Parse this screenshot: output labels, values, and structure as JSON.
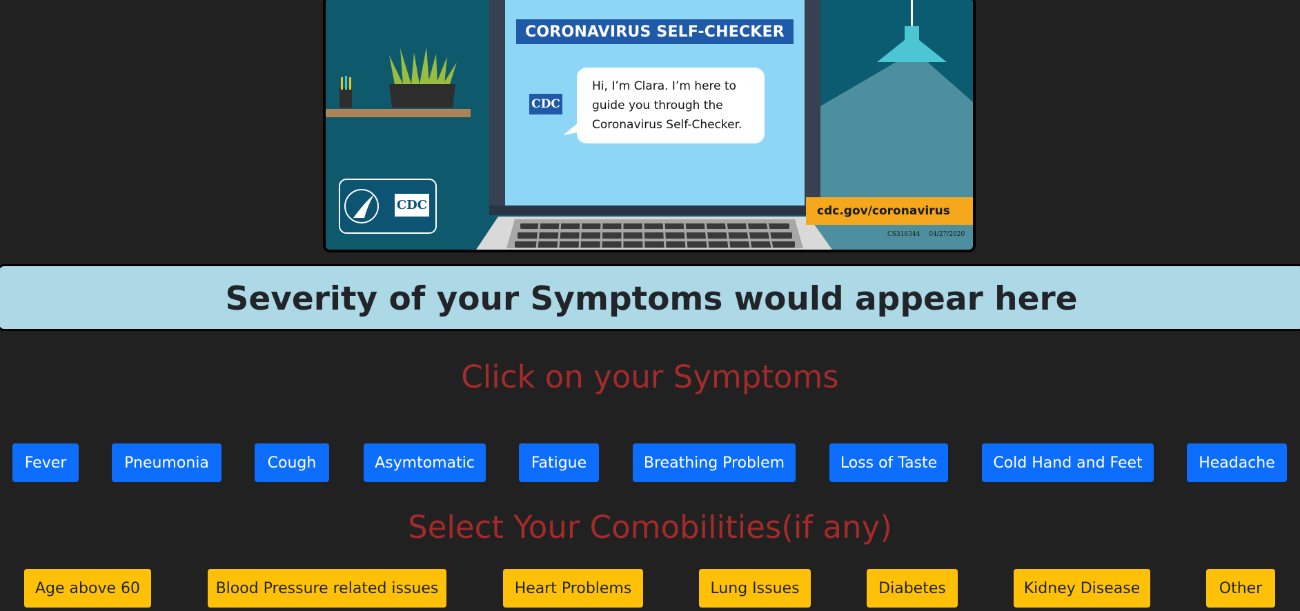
{
  "banner": {
    "screen_title": "CORONAVIRUS SELF-CHECKER",
    "bubble_lines": [
      "Hi, I’m Clara. I’m here to",
      "guide you through the",
      "Coronavirus Self-Checker."
    ],
    "cdc_label": "CDC",
    "url": "cdc.gov/coronavirus",
    "code": "CS316344",
    "date": "04/27/2020"
  },
  "severity": {
    "text": "Severity of your Symptoms would appear here"
  },
  "symptoms": {
    "title": "Click on your Symptoms",
    "items": [
      "Fever",
      "Pneumonia",
      "Cough",
      "Asymtomatic",
      "Fatigue",
      "Breathing Problem",
      "Loss of Taste",
      "Cold Hand and Feet",
      "Headache"
    ]
  },
  "comorbidities": {
    "title": "Select Your Comobilities(if any)",
    "items": [
      "Age above 60",
      "Blood Pressure related issues",
      "Heart Problems",
      "Lung Issues",
      "Diabetes",
      "Kidney Disease",
      "Other"
    ]
  },
  "colors": {
    "background": "#212121",
    "severity_bg": "#add8e6",
    "title_red": "#a52a2a",
    "primary_blue": "#0d6efd",
    "warning_yellow": "#ffc107"
  }
}
